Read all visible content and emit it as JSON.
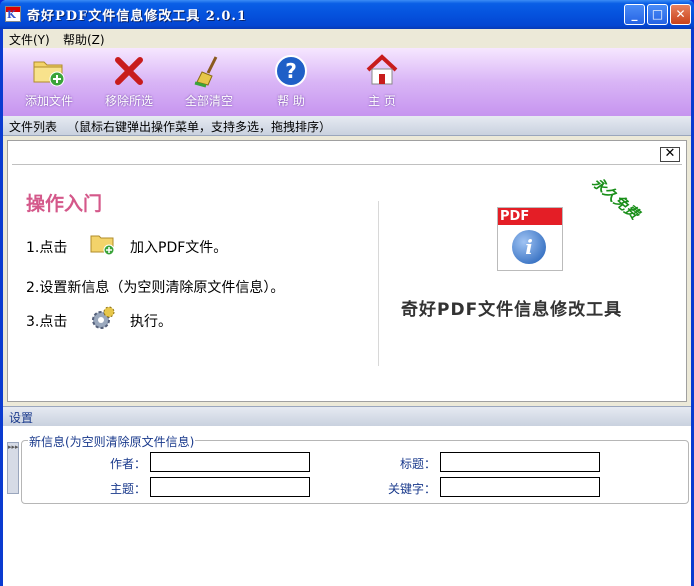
{
  "window": {
    "title": "奇好PDF文件信息修改工具 2.0.1",
    "app_icon_letter": "K"
  },
  "title_buttons": {
    "minimize": "_",
    "maximize": "□",
    "close": "✕"
  },
  "menu": {
    "items": [
      {
        "label": "文件(Y)",
        "icon": "file-menu"
      },
      {
        "label": "帮助(Z)",
        "icon": "help-menu"
      }
    ]
  },
  "toolbar": {
    "items": [
      {
        "label": "添加文件",
        "icon": "add-folder-icon"
      },
      {
        "label": "移除所选",
        "icon": "remove-x-icon"
      },
      {
        "label": "全部清空",
        "icon": "broom-icon"
      },
      {
        "label": "帮 助",
        "icon": "help-icon"
      },
      {
        "label": "主 页",
        "icon": "home-icon"
      }
    ]
  },
  "file_list": {
    "label": "文件列表",
    "hint": "（鼠标右键弹出操作菜单，支持多选，拖拽排序）",
    "close_label": "✕"
  },
  "guide": {
    "title": "操作入门",
    "step1_prefix": "1.点击",
    "step1_suffix": "加入PDF文件。",
    "step2": "2.设置新信息（为空则清除原文件信息）。",
    "step3_prefix": "3.点击",
    "step3_suffix": "执行。"
  },
  "brand": {
    "logo_band": "PDF",
    "logo_symbol": "i",
    "stamp": "永久免费",
    "name": "奇好PDF文件信息修改工具"
  },
  "settings": {
    "label": "设置",
    "group_title": "新信息(为空则清除原文件信息)",
    "collapse_tab": "▸▸▸",
    "fields": {
      "author": {
        "label": "作者：",
        "value": ""
      },
      "title": {
        "label": "标题：",
        "value": ""
      },
      "subject": {
        "label": "主题：",
        "value": ""
      },
      "keywords": {
        "label": "关键字：",
        "value": ""
      }
    }
  },
  "colors": {
    "title_bar": "#0552dd",
    "toolbar_top": "#f6e7ff",
    "toolbar_bottom": "#c694ef",
    "guide_title": "#d4588a",
    "stamp": "#1a8f1a",
    "pdf_red": "#e41e26"
  }
}
